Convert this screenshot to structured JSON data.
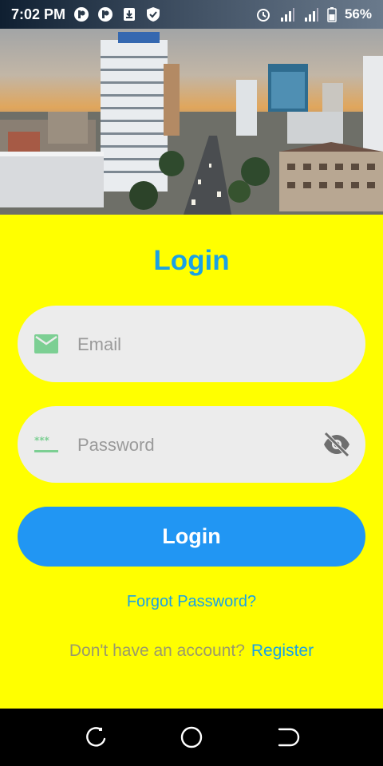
{
  "status_bar": {
    "time": "7:02 PM",
    "battery": "56%",
    "icons_left": [
      "p-icon",
      "p-icon",
      "download-icon",
      "shield-check-icon"
    ],
    "icons_right": [
      "alarm-icon",
      "signal-icon",
      "signal-icon",
      "battery-icon"
    ]
  },
  "hero": {
    "description_icon": "city-skyline-image"
  },
  "login": {
    "title": "Login",
    "email_placeholder": "Email",
    "password_placeholder": "Password",
    "button_label": "Login",
    "forgot_label": "Forgot Password?",
    "no_account_text": "Don't have an account?",
    "register_label": "Register"
  },
  "colors": {
    "background": "#ffff00",
    "accent": "#1aa1e5",
    "button": "#2196f3",
    "field": "#ececec",
    "field_icon": "#7ccf93"
  }
}
